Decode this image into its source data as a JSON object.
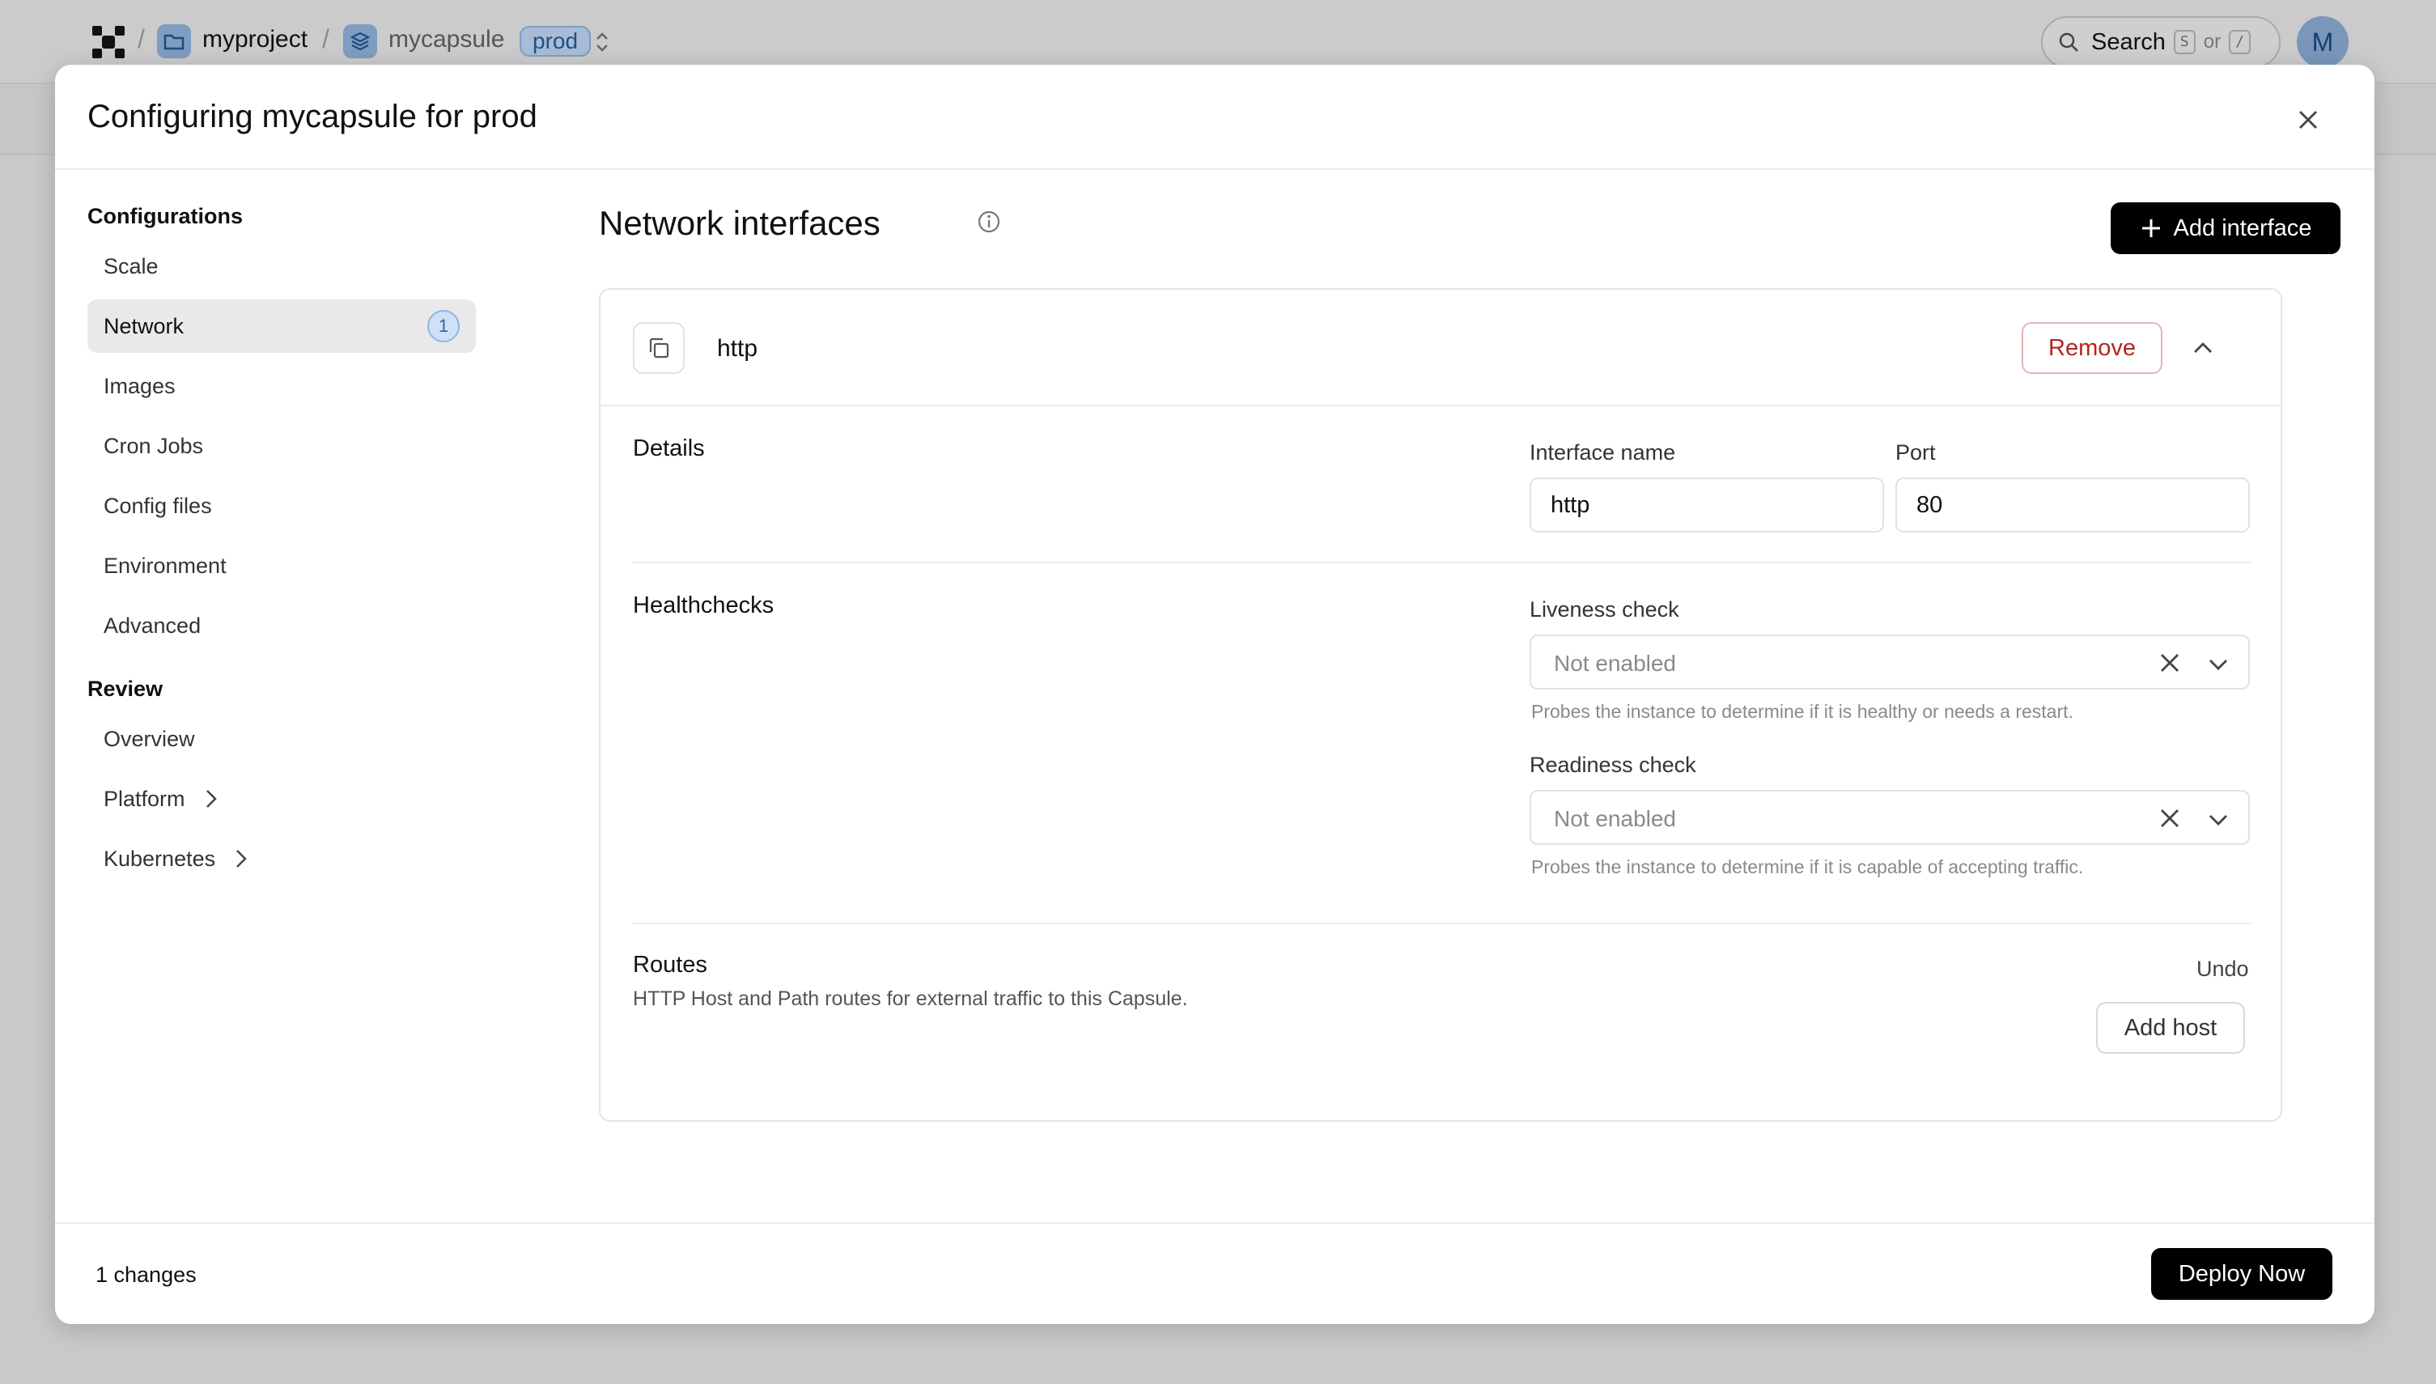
{
  "topbar": {
    "project": "myproject",
    "capsule": "mycapsule",
    "env": "prod",
    "search_label": "Search",
    "search_key1": "S",
    "search_or": "or",
    "search_key2": "/",
    "avatar_initial": "M"
  },
  "modal": {
    "title": "Configuring mycapsule for prod",
    "sidebar": {
      "configurations_heading": "Configurations",
      "config_items": [
        {
          "label": "Scale"
        },
        {
          "label": "Network",
          "badge": "1"
        },
        {
          "label": "Images"
        },
        {
          "label": "Cron Jobs"
        },
        {
          "label": "Config files"
        },
        {
          "label": "Environment"
        },
        {
          "label": "Advanced"
        }
      ],
      "review_heading": "Review",
      "review_items": [
        {
          "label": "Overview"
        },
        {
          "label": "Platform"
        },
        {
          "label": "Kubernetes"
        }
      ]
    },
    "main": {
      "section_title": "Network interfaces",
      "add_interface_label": "Add interface",
      "interface": {
        "name": "http",
        "remove_label": "Remove",
        "details_label": "Details",
        "interface_name_label": "Interface name",
        "interface_name_value": "http",
        "port_label": "Port",
        "port_value": "80",
        "healthchecks_label": "Healthchecks",
        "liveness_label": "Liveness check",
        "liveness_placeholder": "Not enabled",
        "liveness_help": "Probes the instance to determine if it is healthy or needs a restart.",
        "readiness_label": "Readiness check",
        "readiness_placeholder": "Not enabled",
        "readiness_help": "Probes the instance to determine if it is capable of accepting traffic.",
        "routes_label": "Routes",
        "routes_desc": "HTTP Host and Path routes for external traffic to this Capsule.",
        "undo_label": "Undo",
        "add_host_label": "Add host"
      }
    },
    "footer": {
      "changes": "1 changes",
      "deploy_label": "Deploy Now"
    }
  }
}
